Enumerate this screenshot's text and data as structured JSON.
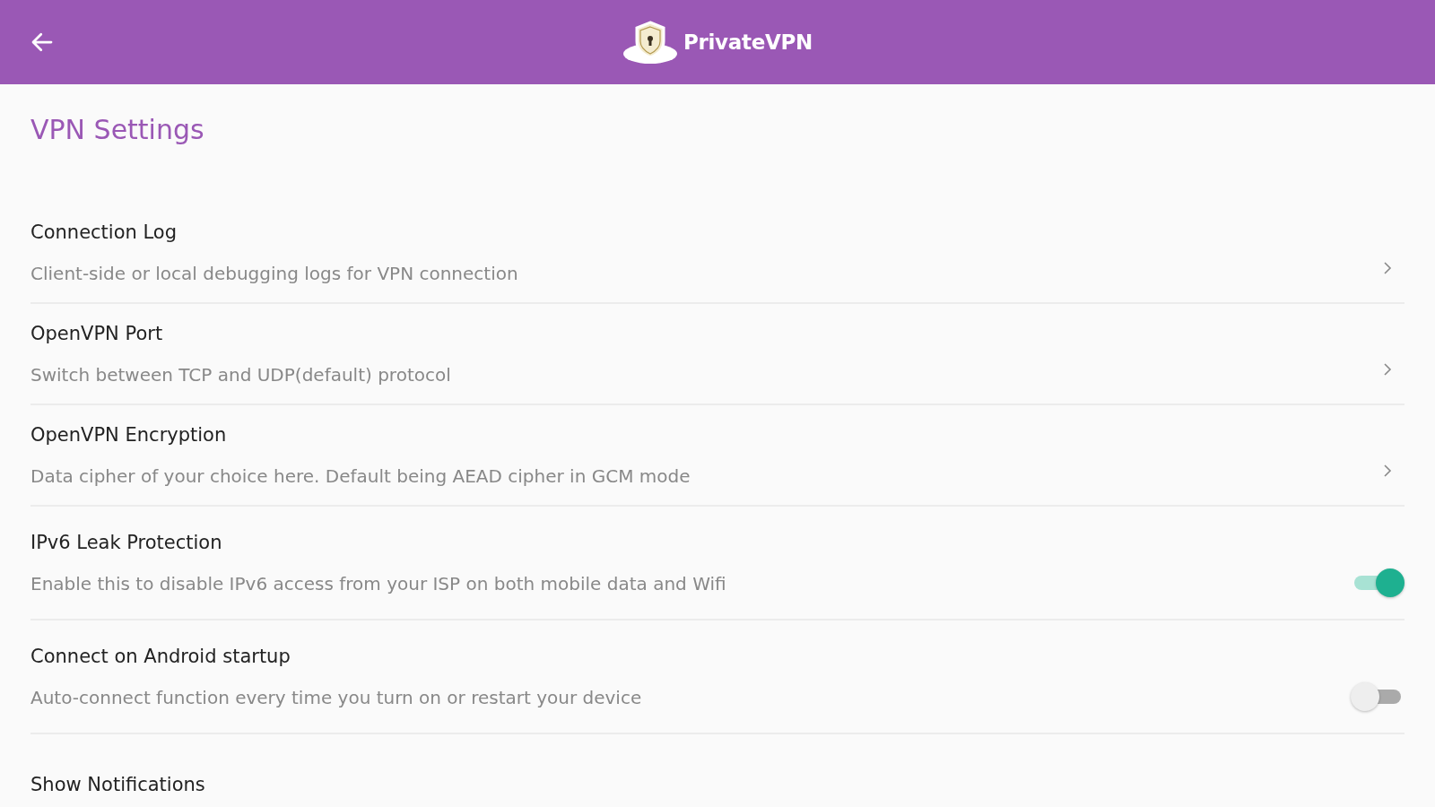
{
  "app_bar": {
    "brand": "PrivateVPN"
  },
  "page_title": "VPN Settings",
  "settings": [
    {
      "kind": "link",
      "title": "Connection Log",
      "subtitle": "Client-side or local debugging logs for VPN connection"
    },
    {
      "kind": "link",
      "title": "OpenVPN Port",
      "subtitle": "Switch between TCP and UDP(default) protocol"
    },
    {
      "kind": "link",
      "title": "OpenVPN Encryption",
      "subtitle": "Data cipher of your choice here. Default being AEAD cipher in GCM mode"
    },
    {
      "kind": "toggle",
      "title": "IPv6 Leak Protection",
      "subtitle": "Enable this to disable IPv6 access from your ISP on both mobile data and Wifi",
      "on": true
    },
    {
      "kind": "toggle",
      "title": "Connect on Android startup",
      "subtitle": "Auto-connect function every time you turn on or restart your device",
      "on": false
    },
    {
      "kind": "heading",
      "title": "Show Notifications"
    }
  ]
}
